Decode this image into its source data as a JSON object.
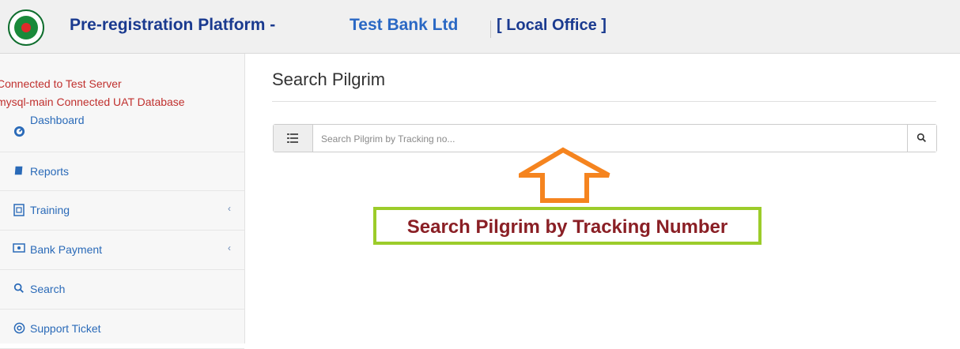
{
  "header": {
    "app_title": "Pre-registration Platform -",
    "bank_name": "Test Bank Ltd",
    "office": "[ Local Office ]"
  },
  "sidebar": {
    "server_status": "Connected to Test Server",
    "db_status": "mysql-main Connected UAT Database",
    "items": [
      {
        "label": "Dashboard",
        "icon": "dashboard-icon"
      },
      {
        "label": "Reports",
        "icon": "book-icon"
      },
      {
        "label": "Training",
        "icon": "training-icon",
        "expandable": true
      },
      {
        "label": "Bank Payment",
        "icon": "money-icon",
        "expandable": true
      },
      {
        "label": "Search",
        "icon": "search-icon"
      },
      {
        "label": "Support Ticket",
        "icon": "support-icon"
      }
    ]
  },
  "main": {
    "page_title": "Search Pilgrim",
    "search_placeholder": "Search Pilgrim by Tracking no..."
  },
  "annotation": {
    "callout_text": "Search Pilgrim by Tracking Number",
    "arrow_color": "#f5841f",
    "border_color": "#9ccc2a",
    "text_color": "#8a1f25"
  },
  "colors": {
    "header_title": "#1a3a8f",
    "bank_name": "#2a68c4",
    "server_status": "#c0302e",
    "nav_link": "#2a6ab8"
  }
}
